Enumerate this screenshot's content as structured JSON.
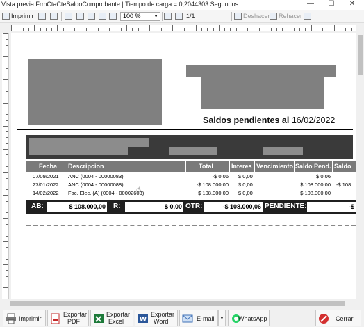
{
  "window": {
    "title": "Vista previa FrmCtaCteSaldoComprobante | Tiempo de carga = 0,2044303 Segundos",
    "minimize_glyph": "—",
    "maximize_glyph": "☐",
    "close_glyph": "✕"
  },
  "toolbar": {
    "print_label": "Imprimir",
    "zoom_value": "100 %",
    "page_indicator": "1/1",
    "undo_label": "Deshacer",
    "redo_label": "Rehacer"
  },
  "document": {
    "title_prefix": "Saldos pendientes al",
    "title_date": "16/02/2022",
    "columns": [
      "Fecha",
      "Descripcion",
      "Total",
      "Interes",
      "Vencimiento",
      "Saldo Pend.",
      "Saldo"
    ],
    "rows": [
      {
        "fecha": "07/09/2021",
        "descripcion": "ANC (0004 - 00000083)",
        "total": "-$ 0,06",
        "interes": "$ 0,00",
        "vencimiento": "",
        "saldo_pend": "$ 0,06",
        "saldo": ""
      },
      {
        "fecha": "27/01/2022",
        "descripcion": "ANC (0004 - 00000088)",
        "total": "-$ 108.000,00",
        "interes": "$ 0,00",
        "vencimiento": "",
        "saldo_pend": "$ 108.000,00",
        "saldo": "-$ 108."
      },
      {
        "fecha": "14/02/2022",
        "descripcion": "Fac. Elec. (A) (0004 - 00002603)",
        "total": "$ 108.000,00",
        "interes": "$ 0,00",
        "vencimiento": "",
        "saldo_pend": "$ 108.000,00",
        "saldo": ""
      }
    ],
    "totals": {
      "ab_label": "AB:",
      "ab_value": "$ 108.000,00",
      "r_label": "R:",
      "r_value": "$ 0,00",
      "otr_label": "OTR:",
      "otr_value": "-$ 108.000,06",
      "pendiente_label": "PENDIENTE:",
      "pendiente_value": "-$"
    }
  },
  "bottombar": {
    "print_label": "Imprimir",
    "pdf_label_1": "Exportar",
    "pdf_label_2": "PDF",
    "excel_label_1": "Exportar",
    "excel_label_2": "Excel",
    "word_label_1": "Exportar",
    "word_label_2": "Word",
    "email_label": "E-mail",
    "whatsapp_label": "WhatsApp",
    "close_label": "Cerrar"
  },
  "colors": {
    "excel": "#1d7a3a",
    "word": "#2b579a",
    "pdf": "#c62828",
    "whatsapp": "#25d366",
    "close": "#d32f2f"
  }
}
